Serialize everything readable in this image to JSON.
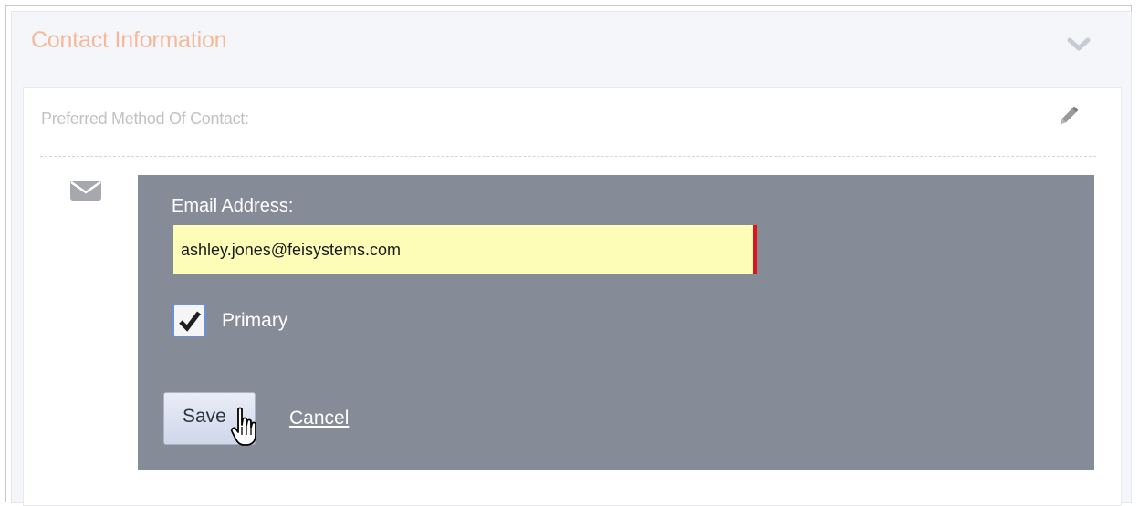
{
  "section": {
    "title": "Contact Information",
    "collapse_icon": "chevron-down-icon"
  },
  "preferred": {
    "label": "Preferred Method Of Contact:",
    "edit_icon": "pencil-icon"
  },
  "email_form": {
    "icon": "envelope-icon",
    "label": "Email Address:",
    "value": "ashley.jones@feisystems.com",
    "primary_label": "Primary",
    "primary_checked": true,
    "save_label": "Save",
    "cancel_label": "Cancel"
  },
  "colors": {
    "title_accent": "#f6b89b",
    "form_background": "#868b98",
    "input_background": "#fdfdb7",
    "validation_bar": "#e0141c"
  }
}
